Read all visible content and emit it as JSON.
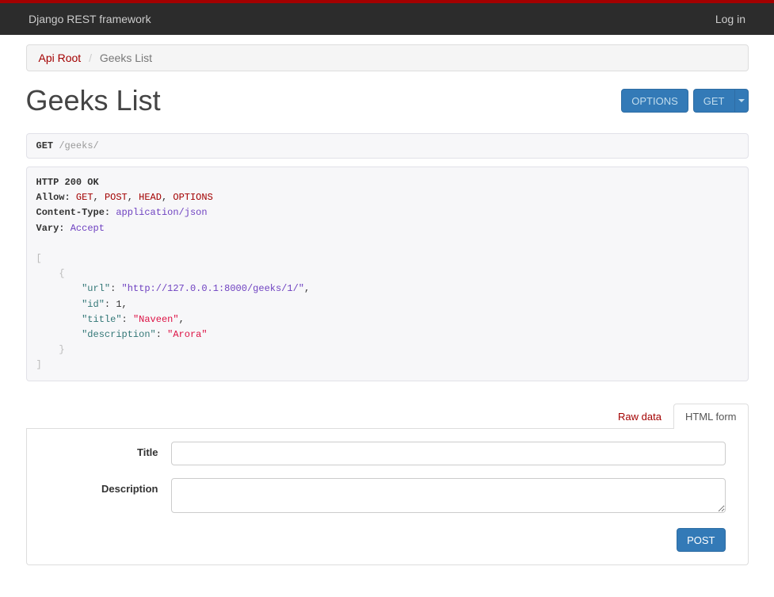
{
  "nav": {
    "brand": "Django REST framework",
    "login": "Log in"
  },
  "breadcrumb": {
    "root": "Api Root",
    "current": "Geeks List"
  },
  "page_title": "Geeks List",
  "buttons": {
    "options": "OPTIONS",
    "get": "GET",
    "post": "POST"
  },
  "request": {
    "method": "GET",
    "path": "/geeks/"
  },
  "response": {
    "status_line": "HTTP 200 OK",
    "headers": {
      "allow_label": "Allow:",
      "allow_values": [
        "GET",
        "POST",
        "HEAD",
        "OPTIONS"
      ],
      "ct_label": "Content-Type:",
      "ct_value": "application/json",
      "vary_label": "Vary:",
      "vary_value": "Accept"
    },
    "body": [
      {
        "url": "http://127.0.0.1:8000/geeks/1/",
        "id": 1,
        "title": "Naveen",
        "description": "Arora"
      }
    ]
  },
  "tabs": {
    "raw": "Raw data",
    "html": "HTML form"
  },
  "form": {
    "title_label": "Title",
    "desc_label": "Description"
  }
}
